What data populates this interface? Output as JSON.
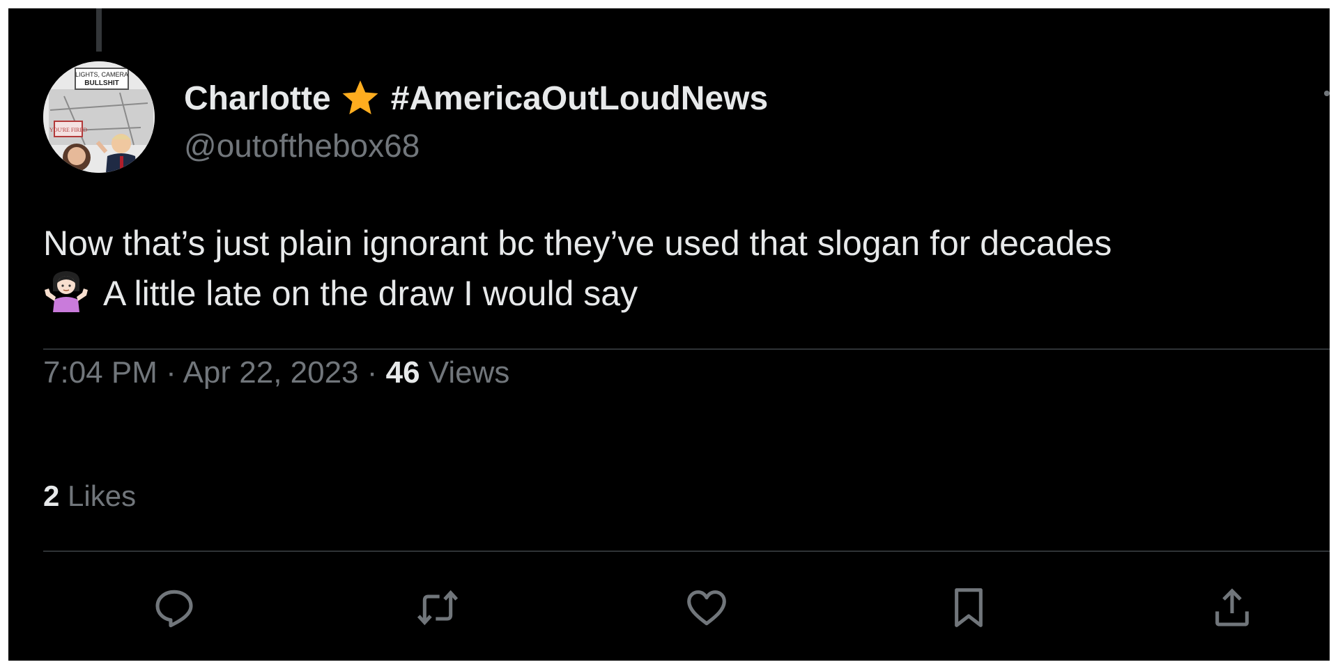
{
  "tweet": {
    "author": {
      "name": "Charlotte",
      "hashtag": "#AmericaOutLoudNews",
      "handle": "@outofthebox68",
      "avatar_text": {
        "sign_top": "LIGHTS, CAMERA",
        "sign_bottom": "BULLSHIT",
        "stamp": "YOU'RE FIRED"
      }
    },
    "text_line1": "Now that’s just plain ignorant bc they’ve used that slogan for decades",
    "text_line2": "A little late on the draw I would say",
    "time": "7:04 PM",
    "separator": "·",
    "date": "Apr 22, 2023",
    "views_count": "46",
    "views_label": "Views",
    "likes_count": "2",
    "likes_label": "Likes"
  },
  "icons": {
    "star": "star-icon",
    "emoji": "person-shrugging-emoji-icon",
    "reply": "reply-icon",
    "retweet": "retweet-icon",
    "like": "heart-icon",
    "bookmark": "bookmark-icon",
    "share": "share-icon"
  },
  "colors": {
    "background": "#000000",
    "primary_text": "#e7e9ea",
    "secondary_text": "#71767b",
    "divider": "#2f3336",
    "star": "#ffad1f"
  }
}
